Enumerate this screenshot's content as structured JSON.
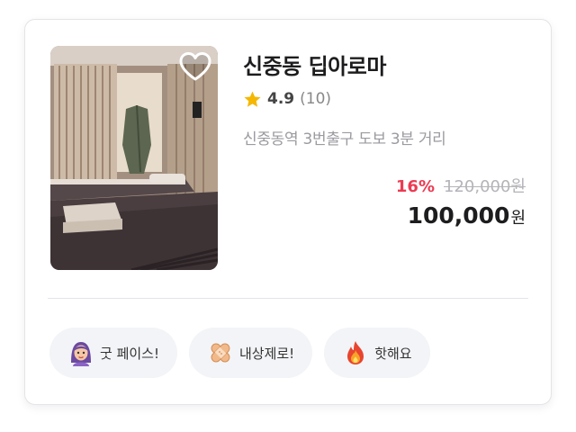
{
  "store": {
    "name": "신중동 딥아로마",
    "rating": "4.9",
    "review_count": "(10)",
    "location": "신중동역 3번출구 도보 3분 거리"
  },
  "price": {
    "discount": "16%",
    "original": "120,000원",
    "final_amount": "100,000",
    "final_unit": "원"
  },
  "tags": [
    {
      "label": "굿 페이스!",
      "icon": "face-woman-icon"
    },
    {
      "label": "내상제로!",
      "icon": "bandage-icon"
    },
    {
      "label": "핫해요",
      "icon": "fire-icon"
    }
  ],
  "colors": {
    "discount": "#ec3b52",
    "star": "#f5b700",
    "tag_bg": "#f3f4f7"
  }
}
